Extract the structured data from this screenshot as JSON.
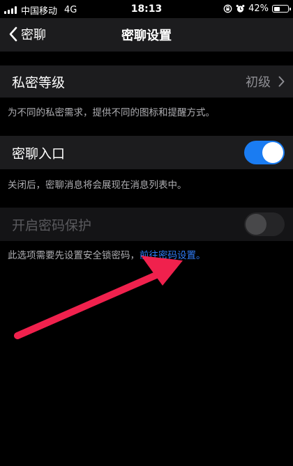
{
  "status_bar": {
    "carrier": "中国移动",
    "network": "4G",
    "time": "18:13",
    "battery": "42%",
    "battery_level": 0.42,
    "icons": [
      "signal-icon",
      "orientation-lock-icon",
      "alarm-icon",
      "battery-icon"
    ]
  },
  "nav": {
    "back_label": "密聊",
    "title": "密聊设置",
    "back_icon": "chevron-left-icon"
  },
  "privacy_level": {
    "label": "私密等级",
    "value": "初级",
    "note": "为不同的私密需求，提供不同的图标和提醒方式。"
  },
  "entry": {
    "label": "密聊入口",
    "enabled": true,
    "note": "关闭后，密聊消息将会展现在消息列表中。"
  },
  "password": {
    "label": "开启密码保护",
    "enabled": false,
    "disabled": true,
    "note_prefix": "此选项需要先设置安全锁密码，",
    "note_link": "前往密码设置。"
  },
  "colors": {
    "accent": "#1a7cf2",
    "link": "#2f7cf6",
    "annotation_arrow": "#f0214d",
    "cell_bg": "#1c1c1e",
    "page_bg": "#000000"
  }
}
